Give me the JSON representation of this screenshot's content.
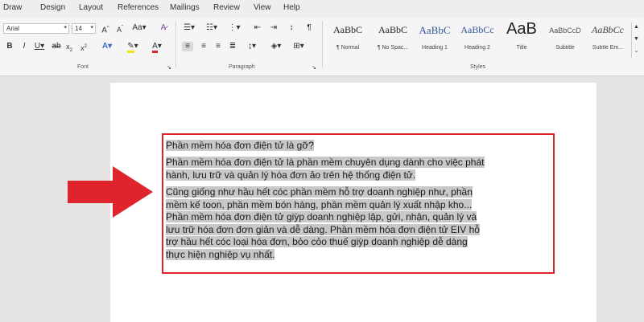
{
  "menu": [
    "Draw",
    "Design",
    "Layout",
    "References",
    "Mailings",
    "Review",
    "View",
    "Help"
  ],
  "font": {
    "name": "Arial",
    "size": "14",
    "group_label": "Font"
  },
  "paragraph": {
    "group_label": "Paragraph"
  },
  "styles": {
    "group_label": "Styles",
    "items": [
      {
        "preview": "AaBbC",
        "name": "¶ Normal"
      },
      {
        "preview": "AaBbC",
        "name": "¶ No Spac..."
      },
      {
        "preview": "AaBbC",
        "name": "Heading 1"
      },
      {
        "preview": "AaBbCc",
        "name": "Heading 2"
      },
      {
        "preview": "AaB",
        "name": "Title"
      },
      {
        "preview": "AaBbCcD",
        "name": "Subtitle"
      },
      {
        "preview": "AaBbCc",
        "name": "Subtle Em..."
      }
    ]
  },
  "colors": {
    "accent_red": "#e0242b",
    "highlight": "#c9c7ca",
    "ribbon_bg": "#f6f5f6"
  },
  "document": {
    "lines": [
      "Phần mềm hóa đơn điện tử là gỡ?",
      "Phần mềm hóa đơn điện tử là phần mềm chuyên dụng dành cho việc phát",
      "hành, lưu trữ và quản lý hóa đơn ảo trên hệ thống điện tử.",
      "Cũng giống như hầu hết cóc phần mềm hỗ trợ doanh nghiệp như, phần",
      "mềm kế toon, phần mềm bón hàng, phần mềm quản lý xuất nhập kho...",
      "Phần mềm hóa đơn điện tử giỳp doanh nghiệp lập, gửi, nhận, quản lý và",
      "lưu trữ hóa đơn đơn giản và dễ dàng. Phần mềm hóa đơn điện tử EIV hỗ",
      "trợ hầu hết cóc loại hóa đơn, bỏo cỏo thuế giỳp doanh nghiệp dễ dàng",
      "thực hiện nghiệp vụ nhất."
    ]
  }
}
